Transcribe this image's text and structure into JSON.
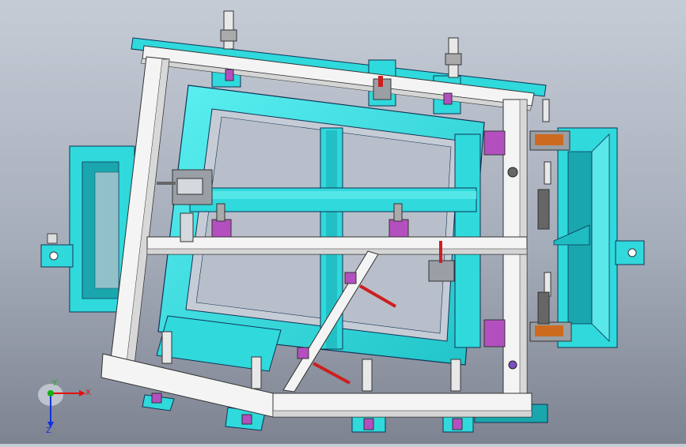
{
  "viewport": {
    "background_top": "#c6ccd6",
    "background_bottom": "#7d8390"
  },
  "colors": {
    "frame_cyan": "#2fd9dc",
    "frame_cyan_dark": "#1aa6ad",
    "steel_white": "#f2f2f2",
    "steel_edge": "#4a4a4a",
    "clamp_magenta": "#b44fc0",
    "clamp_grey": "#8a8f96",
    "handle_red": "#cc1f1f"
  },
  "axis_triad": {
    "x_label": "X",
    "y_label": "Y",
    "z_label": "Z",
    "x_color": "#e01010",
    "y_color": "#10b010",
    "z_color": "#1030e0"
  }
}
